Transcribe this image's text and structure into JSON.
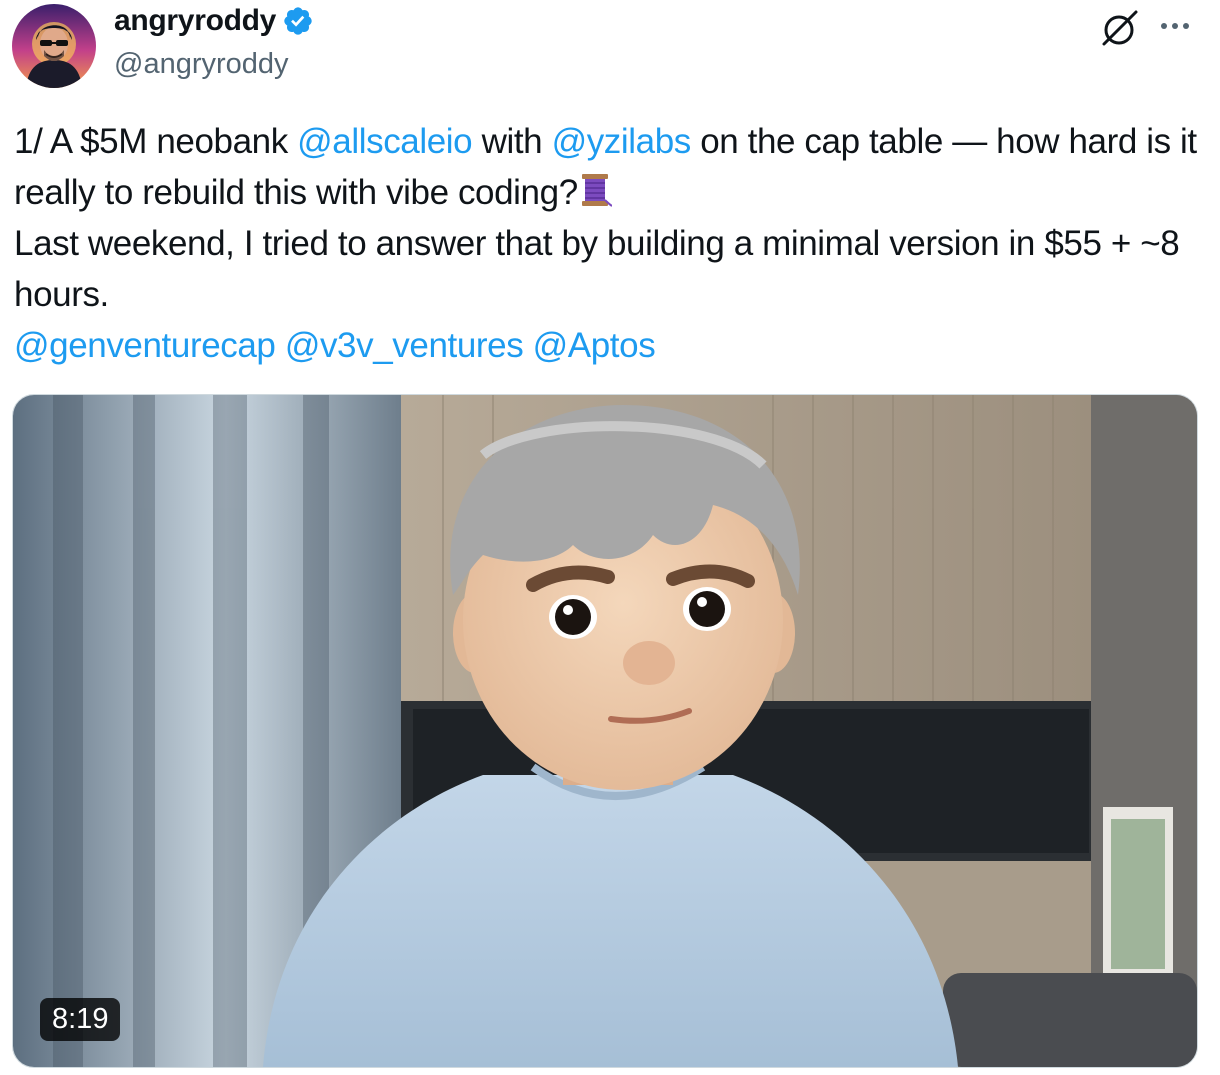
{
  "author": {
    "display_name": "angryroddy",
    "handle": "@angryroddy",
    "verified": true,
    "avatar_icon": "avatar-cyberpunk-icon"
  },
  "actions": {
    "grok_icon": "grok-icon",
    "more_icon": "more-horizontal-icon"
  },
  "tweet": {
    "p1": {
      "t1": "1/ A $5M neobank ",
      "m1": "@allscaleio",
      "t2": " with ",
      "m2": "@yzilabs",
      "t3": " on the cap table — how hard is it really to rebuild this with vibe coding?",
      "emoji": "spool-of-thread-emoji"
    },
    "p2": "Last weekend, I tried to answer that by building a minimal version in $55 + ~8 hours.",
    "mentions": [
      "@genventurecap",
      "@v3v_ventures",
      "@Aptos"
    ]
  },
  "media": {
    "type": "video",
    "duration": "8:19"
  },
  "colors": {
    "link": "#1d9bf0",
    "secondary_text": "#536471",
    "verified": "#1d9bf0"
  }
}
